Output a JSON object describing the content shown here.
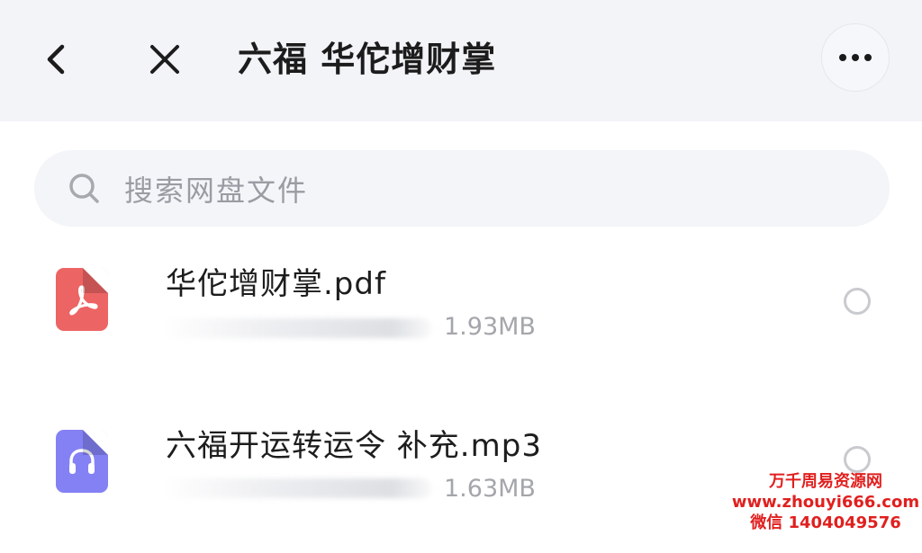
{
  "header": {
    "title": "六福 华佗增财掌",
    "back_icon": "chevron-left-icon",
    "close_icon": "close-icon",
    "more_icon": "more-horizontal-icon"
  },
  "search": {
    "placeholder": "搜索网盘文件",
    "icon": "search-icon"
  },
  "files": [
    {
      "name": "华佗增财掌.pdf",
      "size": "1.93MB",
      "type_icon": "pdf-file-icon",
      "color": "#ec6463",
      "selected": false
    },
    {
      "name": "六福开运转运令 补充.mp3",
      "size": "1.63MB",
      "type_icon": "audio-file-icon",
      "color": "#8481f5",
      "selected": false
    }
  ],
  "watermark": {
    "line1": "万千周易资源网",
    "line2": "www.zhouyi666.com",
    "line3": "微信 1404049576",
    "color": "#e0201f"
  }
}
